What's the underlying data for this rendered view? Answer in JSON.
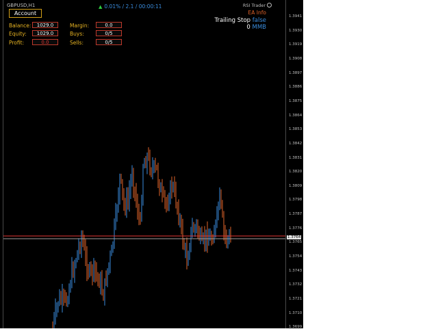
{
  "symbol": "GBPUSD,H1",
  "status": {
    "arrow": "▲",
    "text": "0.01% / 2.1 / 00:00:11"
  },
  "ea_name": "RSI Trader",
  "account_button": "Account",
  "panel": {
    "balance_label": "Balance:",
    "balance_value": "1029.0",
    "equity_label": "Equity:",
    "equity_value": "1029.0",
    "profit_label": "Profit:",
    "profit_value": "0.0",
    "margin_label": "Margin:",
    "margin_value": "0.0",
    "buys_label": "Buys:",
    "buys_value": "0/5",
    "sells_label": "Sells:",
    "sells_value": "0/5"
  },
  "ea_info": "EA Info",
  "trailing_label": "Trailing Stop",
  "trailing_value": "false",
  "mmb_count": "0",
  "mmb_label": "MMB",
  "price_scale": [
    "1.3941",
    "1.3930",
    "1.3919",
    "1.3908",
    "1.3897",
    "1.3886",
    "1.3875",
    "1.3864",
    "1.3853",
    "1.3842",
    "1.3831",
    "1.3820",
    "1.3809",
    "1.3798",
    "1.3787",
    "1.3776",
    "1.3765",
    "1.3754",
    "1.3743",
    "1.3732",
    "1.3721",
    "1.3710",
    "1.3699"
  ],
  "current_price": "1.3764",
  "colors": {
    "background": "#000000",
    "bull": "#3a8dde",
    "bear": "#e0632a",
    "ask_line": "#e53935",
    "bid_line": "#9e9e9e"
  }
}
